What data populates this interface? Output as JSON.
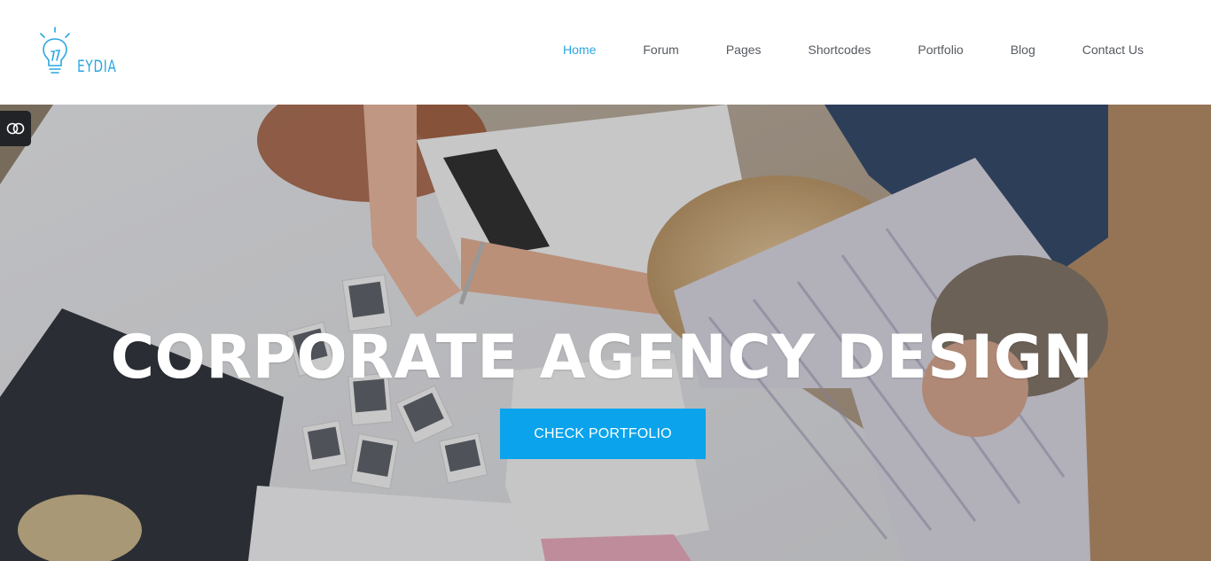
{
  "header": {
    "logo_text": "EYDIA",
    "logo_icon": "lightbulb-icon",
    "brand_color": "#29a6e0"
  },
  "nav": {
    "active_color": "#2ba6e1",
    "items": [
      {
        "label": "Home",
        "active": true
      },
      {
        "label": "Forum"
      },
      {
        "label": "Pages"
      },
      {
        "label": "Shortcodes"
      },
      {
        "label": "Portfolio"
      },
      {
        "label": "Blog"
      },
      {
        "label": "Contact Us"
      }
    ]
  },
  "hero": {
    "title": "CORPORATE AGENCY DESIGN",
    "cta_label": "Check Portfolio",
    "cta_color": "#0aa3ec",
    "toggle_icon": "toggle-icon"
  }
}
